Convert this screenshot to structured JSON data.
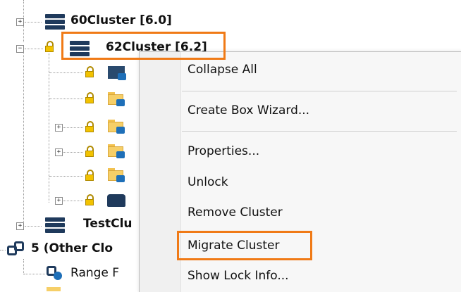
{
  "tree": {
    "nodes": [
      {
        "label": "60Cluster [6.0]",
        "expander": "+"
      },
      {
        "label": "62Cluster [6.2]",
        "expander": "−"
      },
      {
        "label": "TestClu",
        "expander": "+"
      },
      {
        "label": "5 (Other Clo",
        "expander": ""
      },
      {
        "label": "Range F",
        "expander": ""
      }
    ],
    "children_expanders": [
      "",
      "",
      "+",
      "+",
      "",
      "+"
    ]
  },
  "context_menu": {
    "items": [
      {
        "label": "Collapse All"
      },
      {
        "label": "Create Box Wizard..."
      },
      {
        "label": "Properties..."
      },
      {
        "label": "Unlock"
      },
      {
        "label": "Remove Cluster"
      },
      {
        "label": "Migrate Cluster"
      },
      {
        "label": "Show Lock Info..."
      }
    ]
  },
  "colors": {
    "highlight_border": "#f07a16",
    "server_icon": "#1f3a5c",
    "lock": "#f2c200"
  },
  "icons": [
    "server-icon",
    "lock-icon",
    "folder-icon",
    "cluster-group-icon",
    "gear-icon"
  ]
}
